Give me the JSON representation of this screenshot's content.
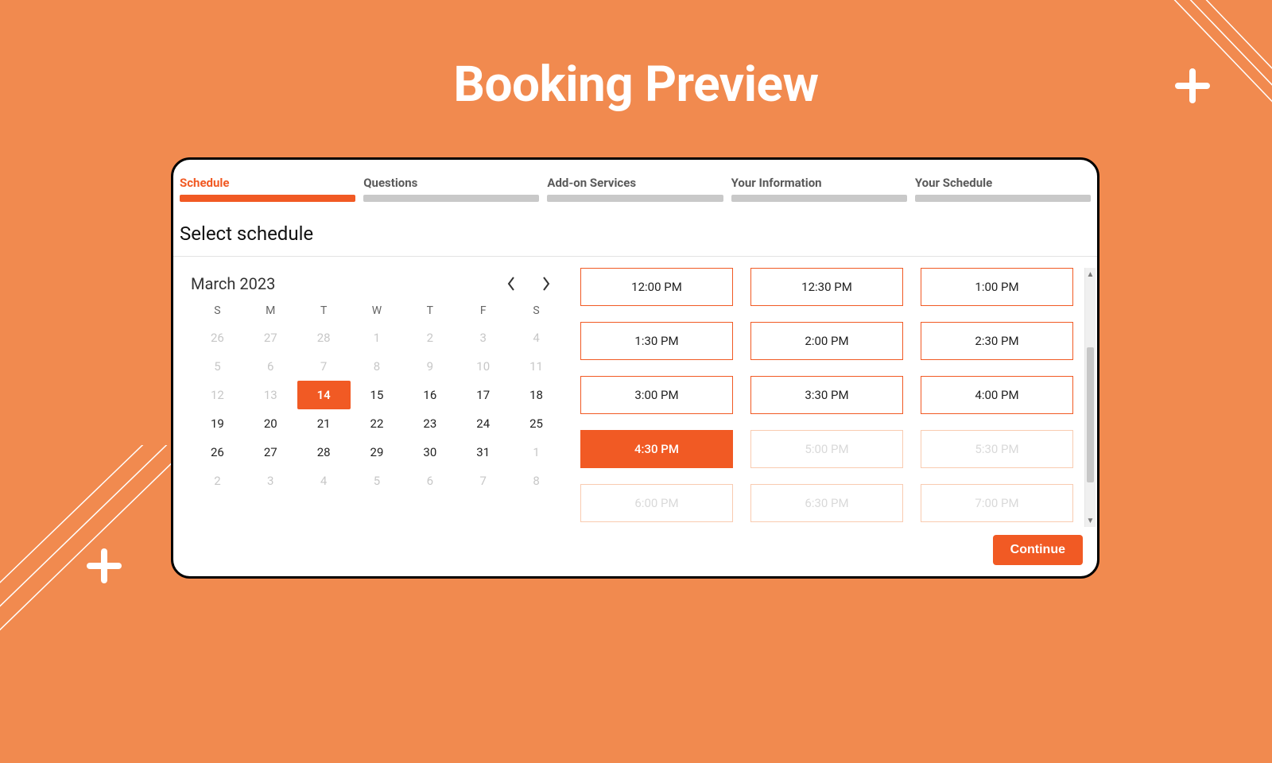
{
  "page_title": "Booking Preview",
  "steps": [
    {
      "label": "Schedule",
      "active": true
    },
    {
      "label": "Questions",
      "active": false
    },
    {
      "label": "Add-on Services",
      "active": false
    },
    {
      "label": "Your Information",
      "active": false
    },
    {
      "label": "Your Schedule",
      "active": false
    }
  ],
  "section_title": "Select schedule",
  "calendar": {
    "month_label": "March  2023",
    "dow": [
      "S",
      "M",
      "T",
      "W",
      "T",
      "F",
      "S"
    ],
    "days": [
      {
        "n": "26",
        "dim": true
      },
      {
        "n": "27",
        "dim": true
      },
      {
        "n": "28",
        "dim": true
      },
      {
        "n": "1",
        "dim": true
      },
      {
        "n": "2",
        "dim": true
      },
      {
        "n": "3",
        "dim": true
      },
      {
        "n": "4",
        "dim": true
      },
      {
        "n": "5",
        "dim": true
      },
      {
        "n": "6",
        "dim": true
      },
      {
        "n": "7",
        "dim": true
      },
      {
        "n": "8",
        "dim": true
      },
      {
        "n": "9",
        "dim": true
      },
      {
        "n": "10",
        "dim": true
      },
      {
        "n": "11",
        "dim": true
      },
      {
        "n": "12",
        "dim": true
      },
      {
        "n": "13",
        "dim": true
      },
      {
        "n": "14",
        "sel": true
      },
      {
        "n": "15"
      },
      {
        "n": "16"
      },
      {
        "n": "17"
      },
      {
        "n": "18"
      },
      {
        "n": "19"
      },
      {
        "n": "20"
      },
      {
        "n": "21"
      },
      {
        "n": "22"
      },
      {
        "n": "23"
      },
      {
        "n": "24"
      },
      {
        "n": "25"
      },
      {
        "n": "26"
      },
      {
        "n": "27"
      },
      {
        "n": "28"
      },
      {
        "n": "29"
      },
      {
        "n": "30"
      },
      {
        "n": "31"
      },
      {
        "n": "1",
        "dim": true
      },
      {
        "n": "2",
        "dim": true
      },
      {
        "n": "3",
        "dim": true
      },
      {
        "n": "4",
        "dim": true
      },
      {
        "n": "5",
        "dim": true
      },
      {
        "n": "6",
        "dim": true
      },
      {
        "n": "7",
        "dim": true
      },
      {
        "n": "8",
        "dim": true
      }
    ]
  },
  "slots": [
    {
      "t": "12:00 PM"
    },
    {
      "t": "12:30 PM"
    },
    {
      "t": "1:00 PM"
    },
    {
      "t": "1:30 PM"
    },
    {
      "t": "2:00 PM"
    },
    {
      "t": "2:30 PM"
    },
    {
      "t": "3:00 PM"
    },
    {
      "t": "3:30 PM"
    },
    {
      "t": "4:00 PM"
    },
    {
      "t": "4:30 PM",
      "selected": true
    },
    {
      "t": "5:00 PM",
      "disabled": true
    },
    {
      "t": "5:30 PM",
      "disabled": true
    },
    {
      "t": "6:00 PM",
      "disabled": true
    },
    {
      "t": "6:30 PM",
      "disabled": true
    },
    {
      "t": "7:00 PM",
      "disabled": true
    }
  ],
  "continue_label": "Continue",
  "colors": {
    "accent": "#F15A24",
    "bg": "#F18A4F"
  }
}
